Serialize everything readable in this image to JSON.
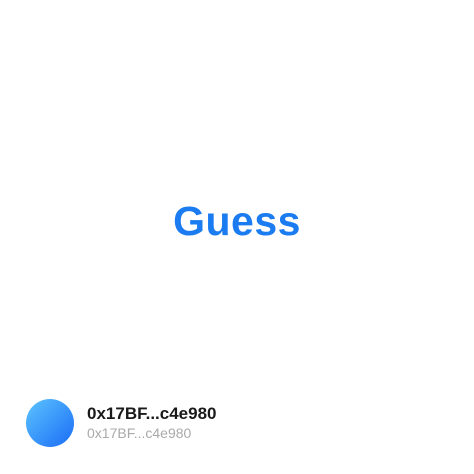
{
  "main": {
    "title": "Guess"
  },
  "account": {
    "address_primary": "0x17BF...c4e980",
    "address_secondary": "0x17BF...c4e980"
  },
  "colors": {
    "accent": "#1a7cf0",
    "avatar_gradient_start": "#5cc4ff",
    "avatar_gradient_end": "#1a6cf6"
  }
}
